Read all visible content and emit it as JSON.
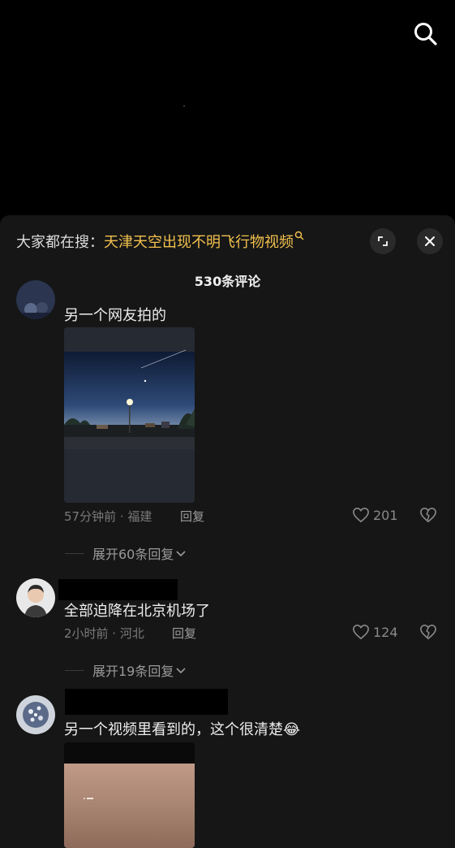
{
  "hot_search": {
    "prefix": "大家都在搜：",
    "keyword": "天津天空出现不明飞行物视频"
  },
  "comments_header": {
    "count_label": "530条评论"
  },
  "comments": [
    {
      "text": "另一个网友拍的",
      "meta": "57分钟前 · 福建",
      "reply_label": "回复",
      "likes": "201",
      "expand_label": "展开60条回复"
    },
    {
      "text": "全部迫降在北京机场了",
      "meta": "2小时前 · 河北",
      "reply_label": "回复",
      "likes": "124",
      "expand_label": "展开19条回复"
    },
    {
      "text": "另一个视频里看到的，这个很清楚",
      "emoji": "😂"
    }
  ],
  "colors": {
    "accent_keyword": "#f2c14e",
    "sheet_bg": "#161616",
    "muted_text": "#7a7a7a"
  }
}
